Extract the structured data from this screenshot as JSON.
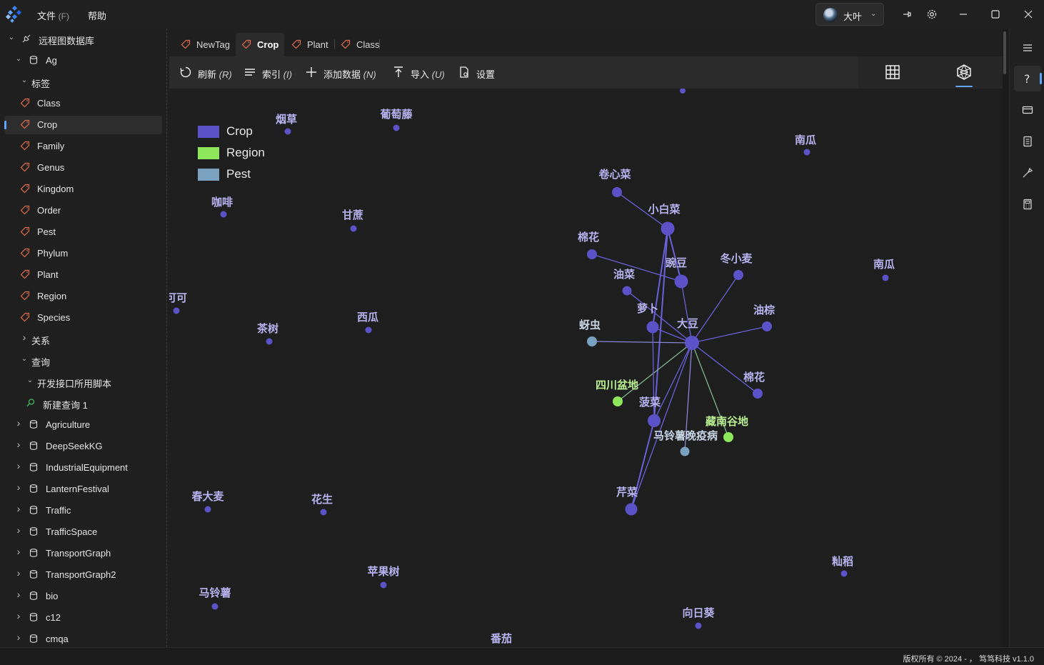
{
  "menu": {
    "file_label": "文件",
    "file_accel": "(F)",
    "help_label": "帮助"
  },
  "user": {
    "name": "大叶"
  },
  "window_controls": [
    "pin-icon",
    "settings-icon",
    "minimize-icon",
    "maximize-icon",
    "close-icon"
  ],
  "sidebar": {
    "rows": [
      {
        "indent": 0,
        "chevron": "down",
        "icon": "remote-db-icon",
        "label": "远程图数据库"
      },
      {
        "indent": 1,
        "chevron": "down",
        "icon": "database-icon",
        "label": "Ag"
      },
      {
        "indent": 2,
        "chevron": "down",
        "icon": "",
        "label": "标签"
      },
      {
        "indent": 3,
        "chevron": "",
        "icon": "tag-icon",
        "label": "Class"
      },
      {
        "indent": 3,
        "chevron": "",
        "icon": "tag-icon",
        "label": "Crop",
        "selected": true
      },
      {
        "indent": 3,
        "chevron": "",
        "icon": "tag-icon",
        "label": "Family"
      },
      {
        "indent": 3,
        "chevron": "",
        "icon": "tag-icon",
        "label": "Genus"
      },
      {
        "indent": 3,
        "chevron": "",
        "icon": "tag-icon",
        "label": "Kingdom"
      },
      {
        "indent": 3,
        "chevron": "",
        "icon": "tag-icon",
        "label": "Order"
      },
      {
        "indent": 3,
        "chevron": "",
        "icon": "tag-icon",
        "label": "Pest"
      },
      {
        "indent": 3,
        "chevron": "",
        "icon": "tag-icon",
        "label": "Phylum"
      },
      {
        "indent": 3,
        "chevron": "",
        "icon": "tag-icon",
        "label": "Plant"
      },
      {
        "indent": 3,
        "chevron": "",
        "icon": "tag-icon",
        "label": "Region"
      },
      {
        "indent": 3,
        "chevron": "",
        "icon": "tag-icon",
        "label": "Species"
      },
      {
        "indent": 2,
        "chevron": "right",
        "icon": "",
        "label": "关系"
      },
      {
        "indent": 2,
        "chevron": "down",
        "icon": "",
        "label": "查询"
      },
      {
        "indent": 3,
        "chevron": "down",
        "icon": "",
        "label": "开发接口所用脚本"
      },
      {
        "indent": 4,
        "chevron": "",
        "icon": "search-icon",
        "label": "新建查询 1"
      },
      {
        "indent": 1,
        "chevron": "right",
        "icon": "database-icon",
        "label": "Agriculture"
      },
      {
        "indent": 1,
        "chevron": "right",
        "icon": "database-icon",
        "label": "DeepSeekKG"
      },
      {
        "indent": 1,
        "chevron": "right",
        "icon": "database-icon",
        "label": "IndustrialEquipment"
      },
      {
        "indent": 1,
        "chevron": "right",
        "icon": "database-icon",
        "label": "LanternFestival"
      },
      {
        "indent": 1,
        "chevron": "right",
        "icon": "database-icon",
        "label": "Traffic"
      },
      {
        "indent": 1,
        "chevron": "right",
        "icon": "database-icon",
        "label": "TrafficSpace"
      },
      {
        "indent": 1,
        "chevron": "right",
        "icon": "database-icon",
        "label": "TransportGraph"
      },
      {
        "indent": 1,
        "chevron": "right",
        "icon": "database-icon",
        "label": "TransportGraph2"
      },
      {
        "indent": 1,
        "chevron": "right",
        "icon": "database-icon",
        "label": "bio"
      },
      {
        "indent": 1,
        "chevron": "right",
        "icon": "database-icon",
        "label": "c12"
      },
      {
        "indent": 1,
        "chevron": "right",
        "icon": "database-icon",
        "label": "cmqa"
      }
    ]
  },
  "tabs": [
    {
      "label": "NewTag",
      "active": false
    },
    {
      "label": "Crop",
      "active": true
    },
    {
      "label": "Plant",
      "active": false
    },
    {
      "label": "Class",
      "active": false
    }
  ],
  "toolbar": {
    "refresh": {
      "label": "刷新",
      "accel": "(R)"
    },
    "index": {
      "label": "索引",
      "accel": "(I)"
    },
    "add_data": {
      "label": "添加数据",
      "accel": "(N)"
    },
    "import": {
      "label": "导入",
      "accel": "(U)"
    },
    "settings": {
      "label": "设置"
    }
  },
  "view_modes": {
    "table": "table-view-icon",
    "graph": "graph-view-icon",
    "active": "graph"
  },
  "legend": [
    {
      "label": "Crop",
      "color": "#5b52c8"
    },
    {
      "label": "Region",
      "color": "#8ee65a"
    },
    {
      "label": "Pest",
      "color": "#7aa1c0"
    }
  ],
  "graph": {
    "colors": {
      "Crop": "#5b52c8",
      "Region": "#8ee65a",
      "Pest": "#7aa1c0",
      "crop_label": "#b9b2f0",
      "region_label": "#b9f08f",
      "pest_label": "#c8d6e6"
    },
    "nodes": [
      {
        "id": "n_top",
        "label": "",
        "type": "Crop"
      },
      {
        "id": "tobacco",
        "label": "烟草",
        "type": "Crop"
      },
      {
        "id": "grape",
        "label": "葡萄藤",
        "type": "Crop"
      },
      {
        "id": "pumpkin1",
        "label": "南瓜",
        "type": "Crop"
      },
      {
        "id": "cabbage",
        "label": "卷心菜",
        "type": "Crop"
      },
      {
        "id": "coffee",
        "label": "咖啡",
        "type": "Crop"
      },
      {
        "id": "sugarcane",
        "label": "甘蔗",
        "type": "Crop"
      },
      {
        "id": "bokchoy",
        "label": "小白菜",
        "type": "Crop"
      },
      {
        "id": "cotton1",
        "label": "棉花",
        "type": "Crop"
      },
      {
        "id": "pea",
        "label": "豌豆",
        "type": "Crop"
      },
      {
        "id": "wwheat",
        "label": "冬小麦",
        "type": "Crop"
      },
      {
        "id": "pumpkin2",
        "label": "南瓜",
        "type": "Crop"
      },
      {
        "id": "rapeseed",
        "label": "油菜",
        "type": "Crop"
      },
      {
        "id": "cocoa",
        "label": "可可",
        "type": "Crop"
      },
      {
        "id": "radish",
        "label": "萝卜",
        "type": "Crop"
      },
      {
        "id": "soybean",
        "label": "大豆",
        "type": "Crop"
      },
      {
        "id": "oilpalm",
        "label": "油棕",
        "type": "Crop"
      },
      {
        "id": "aphid",
        "label": "蚜虫",
        "type": "Pest"
      },
      {
        "id": "tea",
        "label": "茶树",
        "type": "Crop"
      },
      {
        "id": "watermelon",
        "label": "西瓜",
        "type": "Crop"
      },
      {
        "id": "cotton2",
        "label": "棉花",
        "type": "Crop"
      },
      {
        "id": "sichuan",
        "label": "四川盆地",
        "type": "Region"
      },
      {
        "id": "spinach",
        "label": "菠菜",
        "type": "Crop"
      },
      {
        "id": "valley",
        "label": "藏南谷地",
        "type": "Region"
      },
      {
        "id": "blight",
        "label": "马铃薯晚疫病",
        "type": "Pest"
      },
      {
        "id": "celery",
        "label": "芹菜",
        "type": "Crop"
      },
      {
        "id": "springbarley",
        "label": "春大麦",
        "type": "Crop"
      },
      {
        "id": "peanut",
        "label": "花生",
        "type": "Crop"
      },
      {
        "id": "glutinous",
        "label": "籼稻",
        "type": "Crop"
      },
      {
        "id": "apple",
        "label": "苹果树",
        "type": "Crop"
      },
      {
        "id": "potato",
        "label": "马铃薯",
        "type": "Crop"
      },
      {
        "id": "sunflower",
        "label": "向日葵",
        "type": "Crop"
      },
      {
        "id": "tomato",
        "label": "番茄",
        "type": "Crop"
      }
    ],
    "edges": [
      [
        "cabbage",
        "bokchoy"
      ],
      [
        "bokchoy",
        "pea"
      ],
      [
        "bokchoy",
        "radish"
      ],
      [
        "bokchoy",
        "spinach"
      ],
      [
        "cotton1",
        "pea"
      ],
      [
        "rapeseed",
        "soybean"
      ],
      [
        "pea",
        "soybean"
      ],
      [
        "wwheat",
        "soybean"
      ],
      [
        "oilpalm",
        "soybean"
      ],
      [
        "aphid",
        "soybean"
      ],
      [
        "cotton2",
        "soybean"
      ],
      [
        "sichuan",
        "soybean"
      ],
      [
        "spinach",
        "soybean"
      ],
      [
        "valley",
        "soybean"
      ],
      [
        "blight",
        "soybean"
      ],
      [
        "celery",
        "soybean"
      ],
      [
        "radish",
        "soybean"
      ],
      [
        "radish",
        "spinach"
      ],
      [
        "spinach",
        "celery"
      ]
    ]
  },
  "right_rail": [
    "help-icon",
    "card-icon",
    "notes-icon",
    "tools-icon",
    "calculator-icon"
  ],
  "status": {
    "text": "版权所有 © 2024 - ，  笃笃科技   v1.1.0"
  }
}
